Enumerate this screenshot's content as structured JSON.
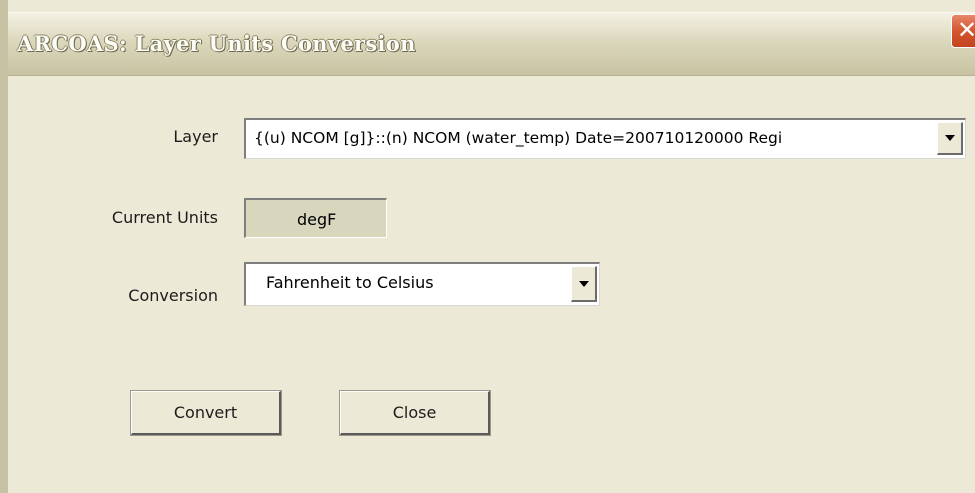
{
  "window": {
    "title": "ARCOAS:  Layer Units Conversion",
    "close_glyph": "✕"
  },
  "form": {
    "layer_label": "Layer",
    "layer_value": "{(u) NCOM [g]}::(n) NCOM (water_temp) Date=200710120000 Regi",
    "current_units_label": "Current Units",
    "current_units_value": "degF",
    "conversion_label": "Conversion",
    "conversion_value": "Fahrenheit to Celsius"
  },
  "buttons": {
    "convert": "Convert",
    "close": "Close"
  },
  "icons": {
    "close": "close-icon",
    "dropdown": "chevron-down-icon"
  },
  "colors": {
    "dialog_background": "#ecead6",
    "close_button": "#d4572f",
    "readonly_field": "#d8d6bd"
  }
}
